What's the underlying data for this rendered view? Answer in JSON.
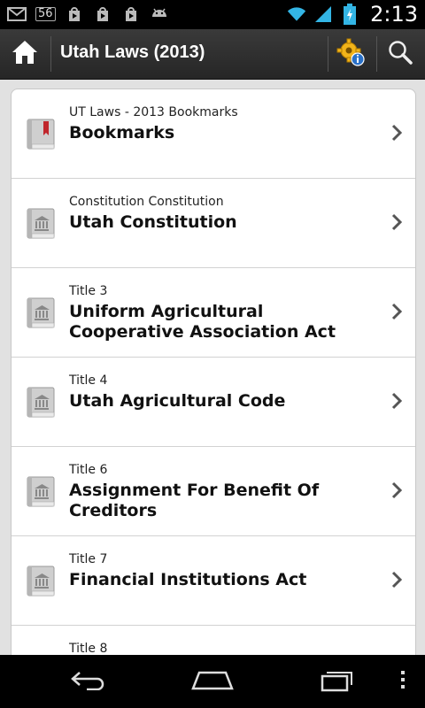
{
  "status_bar": {
    "notification_badge": "56",
    "time": "2:13"
  },
  "action_bar": {
    "title": "Utah Laws (2013)"
  },
  "list": [
    {
      "subtitle": "UT Laws - 2013 Bookmarks",
      "title": "Bookmarks",
      "icon": "bookmark-book-icon"
    },
    {
      "subtitle": "Constitution Constitution",
      "title": "Utah Constitution",
      "icon": "law-book-icon"
    },
    {
      "subtitle": "Title 3",
      "title": "Uniform Agricultural Cooperative Association Act",
      "icon": "law-book-icon"
    },
    {
      "subtitle": "Title 4",
      "title": "Utah Agricultural Code",
      "icon": "law-book-icon"
    },
    {
      "subtitle": "Title 6",
      "title": "Assignment For Benefit Of Creditors",
      "icon": "law-book-icon"
    },
    {
      "subtitle": "Title 7",
      "title": "Financial Institutions Act",
      "icon": "law-book-icon"
    },
    {
      "subtitle": "Title 8",
      "title": "",
      "icon": "law-book-icon"
    }
  ],
  "colors": {
    "bookmark_ribbon": "#c0262c",
    "status_accent": "#33b5e5"
  }
}
